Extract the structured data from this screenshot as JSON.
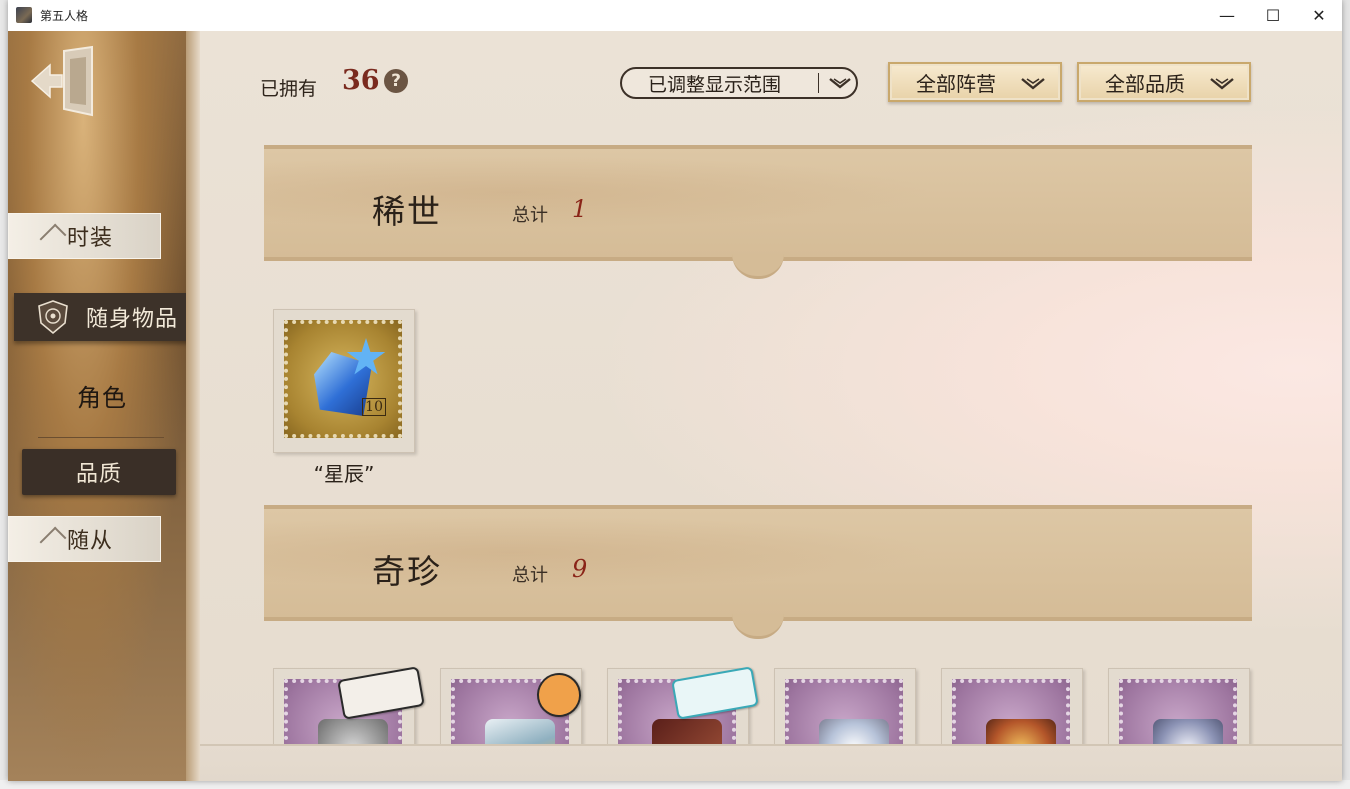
{
  "window": {
    "title": "第五人格",
    "minimize_glyph": "—",
    "maximize_glyph": "☐",
    "close_glyph": "✕"
  },
  "sidebar": {
    "back_icon": "exit-door-icon",
    "tabs": {
      "outfit": "时装",
      "items": "随身物品",
      "role": "角色",
      "quality": "品质",
      "follower": "随从"
    }
  },
  "toolbar": {
    "owned_label": "已拥有",
    "owned_count": "36",
    "help_glyph": "?",
    "range_filter": "已调整显示范围",
    "camp_filter": "全部阵营",
    "quality_filter": "全部品质"
  },
  "sections": [
    {
      "title": "稀世",
      "total_label": "总计",
      "total_value": "1",
      "items": [
        {
          "name": "“星辰”",
          "stamp_value": "10"
        }
      ]
    },
    {
      "title": "奇珍",
      "total_label": "总计",
      "total_value": "9",
      "items": [
        {
          "name": ""
        },
        {
          "name": ""
        },
        {
          "name": ""
        },
        {
          "name": ""
        },
        {
          "name": ""
        },
        {
          "name": ""
        }
      ]
    }
  ],
  "colors": {
    "accent_red": "#8a2418",
    "dark_tab": "#3d3229",
    "gold_stamp": "#c5a04a",
    "purple_stamp": "#a37ba5"
  }
}
